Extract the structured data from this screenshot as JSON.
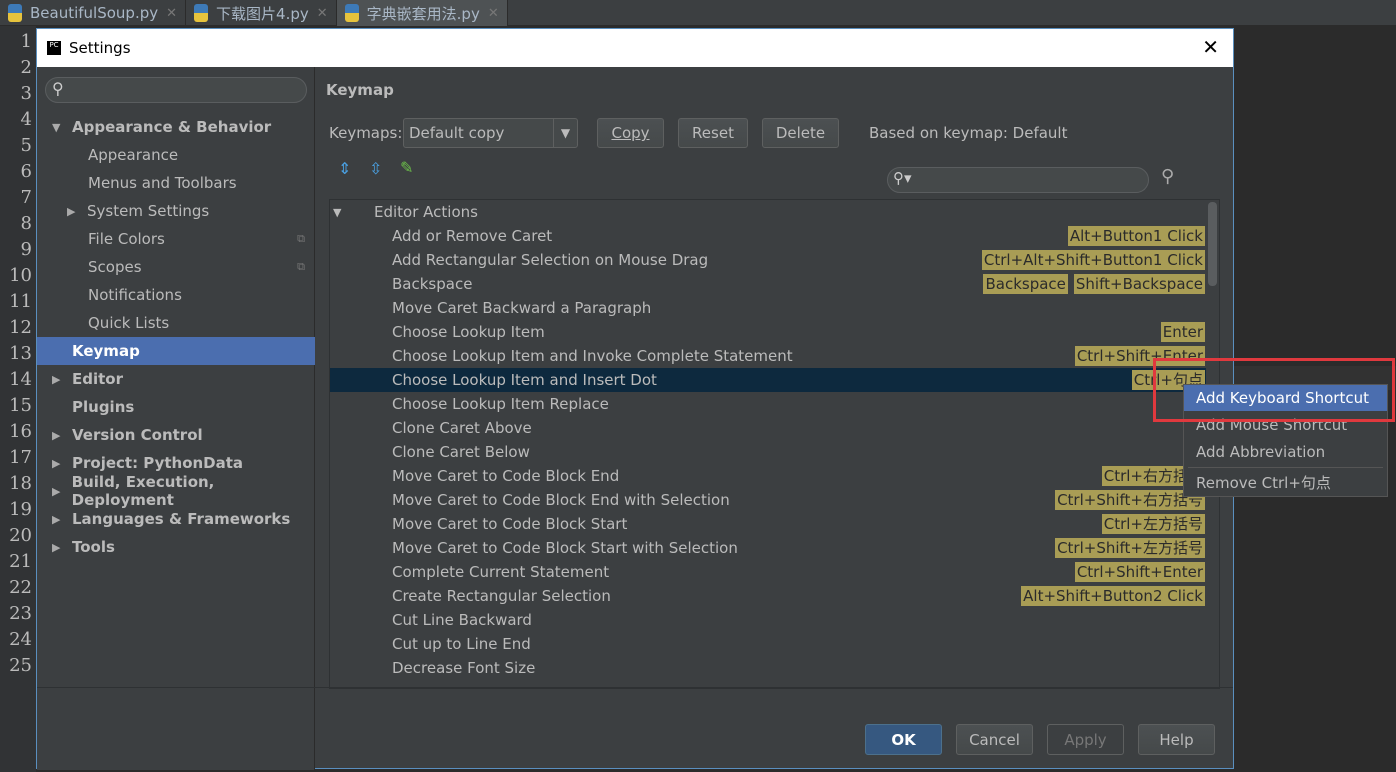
{
  "tabs": [
    {
      "label": "BeautifulSoup.py"
    },
    {
      "label": "下载图片4.py"
    },
    {
      "label": "字典嵌套用法.py"
    }
  ],
  "line_numbers": [
    "1",
    "2",
    "3",
    "4",
    "5",
    "6",
    "7",
    "8",
    "9",
    "10",
    "11",
    "12",
    "13",
    "14",
    "15",
    "16",
    "17",
    "18",
    "19",
    "20",
    "21",
    "22",
    "23",
    "24",
    "25"
  ],
  "dialog": {
    "title": "Settings",
    "close": "✕"
  },
  "sidebar": {
    "items": [
      {
        "label": "Appearance & Behavior",
        "level": 0,
        "bold": true,
        "arrow": "▼"
      },
      {
        "label": "Appearance",
        "level": 1
      },
      {
        "label": "Menus and Toolbars",
        "level": 1
      },
      {
        "label": "System Settings",
        "level": 1,
        "arrow": "▶"
      },
      {
        "label": "File Colors",
        "level": 1,
        "icon": "copy-icon"
      },
      {
        "label": "Scopes",
        "level": 1,
        "icon": "copy-icon"
      },
      {
        "label": "Notifications",
        "level": 1
      },
      {
        "label": "Quick Lists",
        "level": 1
      },
      {
        "label": "Keymap",
        "level": 0,
        "bold": true,
        "selected": true
      },
      {
        "label": "Editor",
        "level": 0,
        "bold": true,
        "arrow": "▶"
      },
      {
        "label": "Plugins",
        "level": 0,
        "bold": true
      },
      {
        "label": "Version Control",
        "level": 0,
        "bold": true,
        "arrow": "▶"
      },
      {
        "label": "Project: PythonData",
        "level": 0,
        "bold": true,
        "arrow": "▶"
      },
      {
        "label": "Build, Execution, Deployment",
        "level": 0,
        "bold": true,
        "arrow": "▶"
      },
      {
        "label": "Languages & Frameworks",
        "level": 0,
        "bold": true,
        "arrow": "▶"
      },
      {
        "label": "Tools",
        "level": 0,
        "bold": true,
        "arrow": "▶"
      }
    ]
  },
  "main": {
    "title": "Keymap",
    "keymaps_label": "Keymaps:",
    "keymap_value": "Default copy",
    "copy": "Copy",
    "reset": "Reset",
    "delete": "Delete",
    "based_on": "Based on keymap: Default",
    "group": "Editor Actions",
    "actions": [
      {
        "name": "Add or Remove Caret",
        "shortcuts": [
          "Alt+Button1 Click"
        ]
      },
      {
        "name": "Add Rectangular Selection on Mouse Drag",
        "shortcuts": [
          "Ctrl+Alt+Shift+Button1 Click"
        ]
      },
      {
        "name": "Backspace",
        "shortcuts": [
          "Backspace",
          "Shift+Backspace"
        ]
      },
      {
        "name": "Move Caret Backward a Paragraph",
        "shortcuts": []
      },
      {
        "name": "Choose Lookup Item",
        "shortcuts": [
          "Enter"
        ]
      },
      {
        "name": "Choose Lookup Item and Invoke Complete Statement",
        "shortcuts": [
          "Ctrl+Shift+Enter"
        ]
      },
      {
        "name": "Choose Lookup Item and Insert Dot",
        "shortcuts": [
          "Ctrl+句点"
        ],
        "selected": true
      },
      {
        "name": "Choose Lookup Item Replace",
        "shortcuts": []
      },
      {
        "name": "Clone Caret Above",
        "shortcuts": []
      },
      {
        "name": "Clone Caret Below",
        "shortcuts": []
      },
      {
        "name": "Move Caret to Code Block End",
        "shortcuts": [
          "Ctrl+右方括号"
        ]
      },
      {
        "name": "Move Caret to Code Block End with Selection",
        "shortcuts": [
          "Ctrl+Shift+右方括号"
        ]
      },
      {
        "name": "Move Caret to Code Block Start",
        "shortcuts": [
          "Ctrl+左方括号"
        ]
      },
      {
        "name": "Move Caret to Code Block Start with Selection",
        "shortcuts": [
          "Ctrl+Shift+左方括号"
        ]
      },
      {
        "name": "Complete Current Statement",
        "shortcuts": [
          "Ctrl+Shift+Enter"
        ]
      },
      {
        "name": "Create Rectangular Selection",
        "shortcuts": [
          "Alt+Shift+Button2 Click"
        ]
      },
      {
        "name": "Cut Line Backward",
        "shortcuts": []
      },
      {
        "name": "Cut up to Line End",
        "shortcuts": []
      },
      {
        "name": "Decrease Font Size",
        "shortcuts": []
      }
    ]
  },
  "context_menu": {
    "items": [
      "Add Keyboard Shortcut",
      "Add Mouse Shortcut",
      "Add Abbreviation",
      "Remove Ctrl+句点"
    ]
  },
  "footer": {
    "ok": "OK",
    "cancel": "Cancel",
    "apply": "Apply",
    "help": "Help"
  },
  "colors": {
    "selection": "#4b6eaf",
    "shortcut_badge": "#a99d55",
    "highlight_box": "#e0393e"
  }
}
